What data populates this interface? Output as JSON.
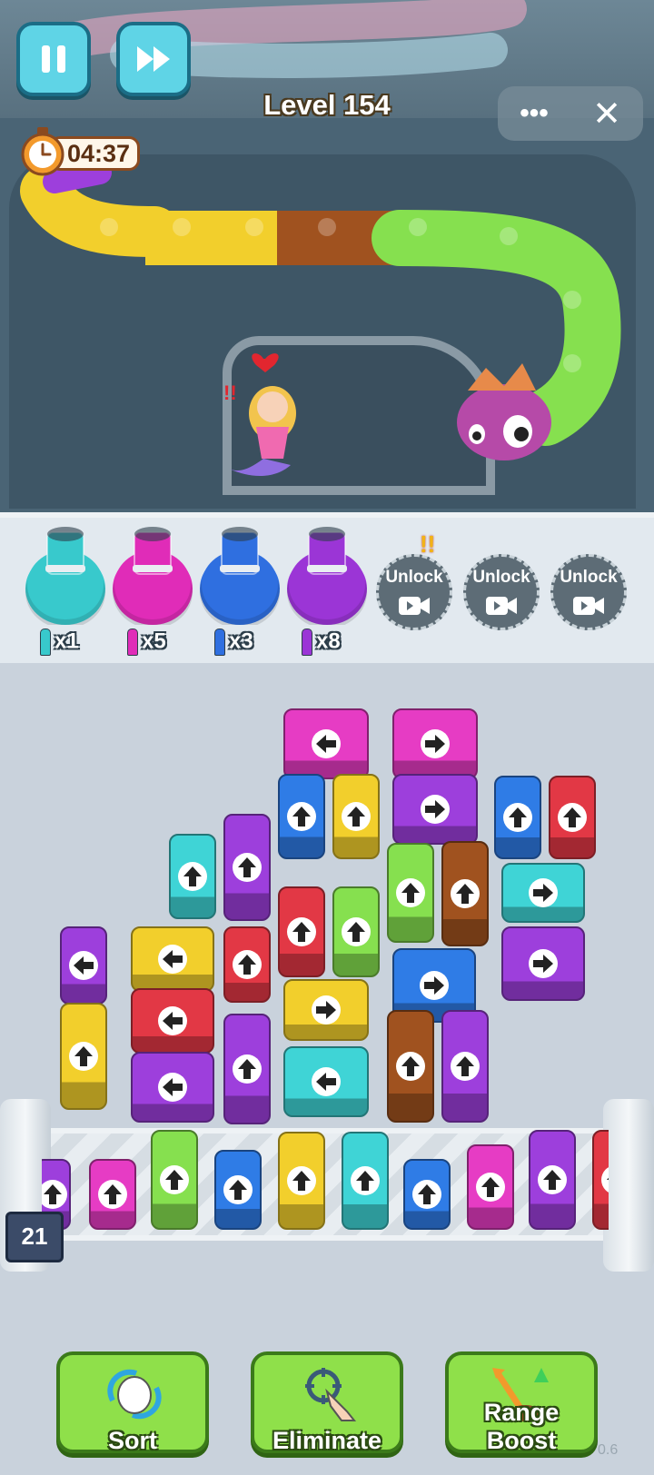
{
  "header": {
    "level": "Level 154",
    "timer": "04:37"
  },
  "tray": {
    "pots": [
      {
        "color": "#38c9cc",
        "count": "x1"
      },
      {
        "color": "#e02cb8",
        "count": "x5"
      },
      {
        "color": "#2f6fe0",
        "count": "x3"
      },
      {
        "color": "#9b35d6",
        "count": "x8"
      }
    ],
    "locked_slots": [
      {
        "label": "Unlock"
      },
      {
        "label": "Unlock"
      },
      {
        "label": "Unlock"
      }
    ]
  },
  "palette": {
    "magenta": "#e63cc4",
    "purple": "#9d3fdc",
    "blue": "#2f7ce6",
    "yellow": "#f2cf2c",
    "red": "#e23845",
    "cyan": "#3fd4d6",
    "green": "#86e04f",
    "brown": "#a0521f"
  },
  "blocks": [
    {
      "color": "magenta",
      "dir": "left"
    },
    {
      "color": "magenta",
      "dir": "right"
    },
    {
      "color": "blue",
      "dir": "up"
    },
    {
      "color": "yellow",
      "dir": "up"
    },
    {
      "color": "purple",
      "dir": "right"
    },
    {
      "color": "blue",
      "dir": "up"
    },
    {
      "color": "red",
      "dir": "up"
    },
    {
      "color": "cyan",
      "dir": "up"
    },
    {
      "color": "purple",
      "dir": "up"
    },
    {
      "color": "green",
      "dir": "up"
    },
    {
      "color": "brown",
      "dir": "up"
    },
    {
      "color": "cyan",
      "dir": "right"
    },
    {
      "color": "red",
      "dir": "up"
    },
    {
      "color": "green",
      "dir": "up"
    },
    {
      "color": "purple",
      "dir": "left"
    },
    {
      "color": "yellow",
      "dir": "left"
    },
    {
      "color": "red",
      "dir": "up"
    },
    {
      "color": "purple",
      "dir": "right"
    },
    {
      "color": "blue",
      "dir": "right"
    },
    {
      "color": "red",
      "dir": "left"
    },
    {
      "color": "yellow",
      "dir": "right"
    },
    {
      "color": "yellow",
      "dir": "up"
    },
    {
      "color": "purple",
      "dir": "left"
    },
    {
      "color": "purple",
      "dir": "up"
    },
    {
      "color": "cyan",
      "dir": "left"
    },
    {
      "color": "brown",
      "dir": "up"
    },
    {
      "color": "purple",
      "dir": "up"
    }
  ],
  "conveyor": {
    "counter": "21",
    "blocks": [
      {
        "color": "purple",
        "dir": "up"
      },
      {
        "color": "magenta",
        "dir": "up"
      },
      {
        "color": "green",
        "dir": "up"
      },
      {
        "color": "blue",
        "dir": "up"
      },
      {
        "color": "yellow",
        "dir": "up"
      },
      {
        "color": "cyan",
        "dir": "up"
      },
      {
        "color": "blue",
        "dir": "up"
      },
      {
        "color": "magenta",
        "dir": "up"
      },
      {
        "color": "purple",
        "dir": "up"
      },
      {
        "color": "red",
        "dir": "up"
      }
    ]
  },
  "boosters": [
    {
      "label": "Sort",
      "icon": "sort-icon"
    },
    {
      "label": "Eliminate",
      "icon": "eliminate-icon"
    },
    {
      "label": "Range Boost",
      "icon": "range-boost-icon"
    }
  ],
  "version": "0.6"
}
